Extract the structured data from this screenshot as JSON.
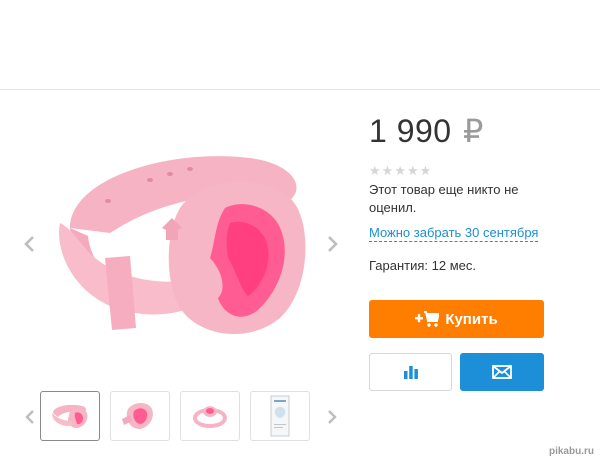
{
  "product": {
    "price": "1 990",
    "currency": "₽",
    "rating_stars": 0,
    "rating_max": 5,
    "no_rating_text": "Этот товар еще никто не оценил.",
    "pickup_text": "Можно забрать 30 сентября",
    "warranty_text": "Гарантия: 12 мес."
  },
  "actions": {
    "buy_label": "Купить",
    "buy_icon": "cart-plus-icon",
    "compare_icon": "bar-chart-icon",
    "mail_icon": "envelope-icon"
  },
  "gallery": {
    "prev_icon": "chevron-left-icon",
    "next_icon": "chevron-right-icon",
    "thumbnails": [
      "bracelet-front",
      "bracelet-side",
      "bracelet-top",
      "packaging"
    ],
    "active_thumbnail": 0
  },
  "colors": {
    "buy_button": "#ff7e00",
    "link": "#1c8fd8",
    "mail_button": "#1c8fd8",
    "product_pink": "#f7b6c6",
    "product_inner": "#ff4f8a"
  },
  "watermark": "pikabu.ru"
}
